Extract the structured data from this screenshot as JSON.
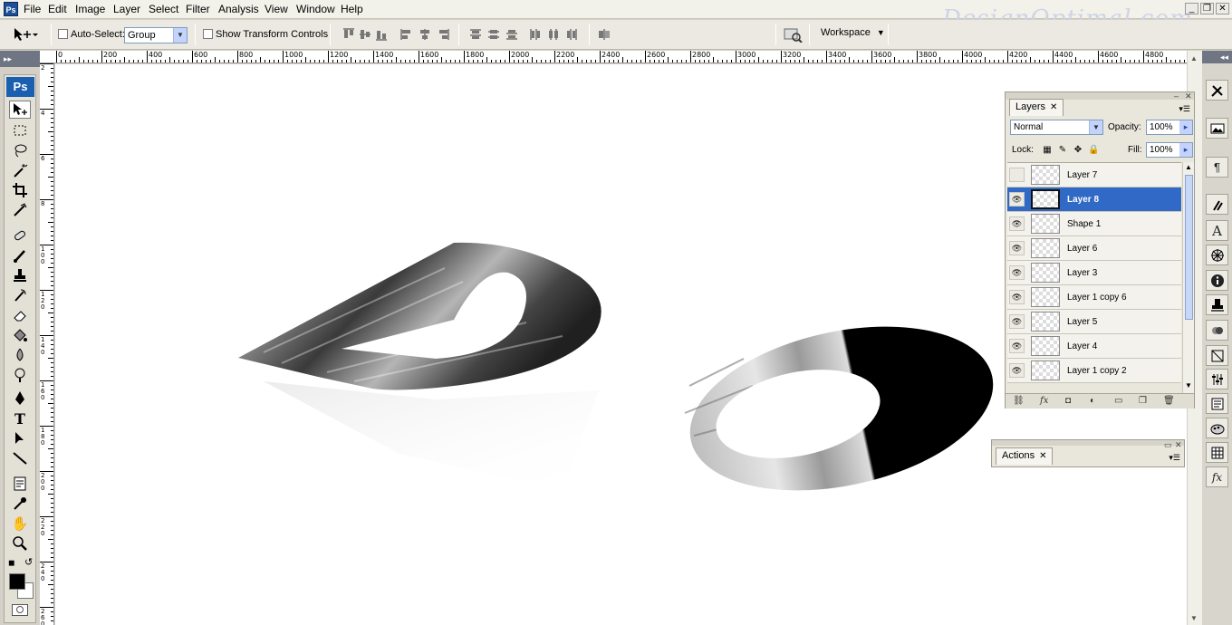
{
  "menubar": {
    "items": [
      "File",
      "Edit",
      "Image",
      "Layer",
      "Select",
      "Filter",
      "Analysis",
      "View",
      "Window",
      "Help"
    ],
    "watermark": "DesignOptimal.com"
  },
  "options": {
    "auto_select_label": "Auto-Select:",
    "auto_select_value": "Group",
    "show_transform_label": "Show Transform Controls",
    "workspace_label": "Workspace"
  },
  "ruler": {
    "top_labels": [
      "0",
      "200",
      "400",
      "600",
      "800",
      "1000",
      "1200",
      "1400",
      "1600",
      "1800",
      "2000",
      "2200",
      "2400",
      "2600",
      "2800",
      "3000",
      "3200",
      "3400",
      "3600",
      "3800",
      "4000",
      "4200",
      "4400",
      "4600",
      "4800"
    ],
    "left_labels": [
      "2",
      "4",
      "6",
      "8",
      "1\n0\n0",
      "1\n2\n0",
      "1\n4\n0",
      "1\n6\n0",
      "1\n8\n0",
      "2\n0\n0",
      "2\n2\n0",
      "2\n4\n0",
      "2\n6\n0"
    ]
  },
  "toolbox": {
    "logo": "Ps"
  },
  "layers_panel": {
    "tab_label": "Layers",
    "blend_mode": "Normal",
    "opacity_label": "Opacity:",
    "opacity_value": "100%",
    "lock_label": "Lock:",
    "fill_label": "Fill:",
    "fill_value": "100%",
    "layers": [
      {
        "name": "Layer 7",
        "visible": false,
        "selected": false
      },
      {
        "name": "Layer 8",
        "visible": true,
        "selected": true
      },
      {
        "name": "Shape 1",
        "visible": true,
        "selected": false
      },
      {
        "name": "Layer 6",
        "visible": true,
        "selected": false
      },
      {
        "name": "Layer 3",
        "visible": true,
        "selected": false
      },
      {
        "name": "Layer 1 copy 6",
        "visible": true,
        "selected": false
      },
      {
        "name": "Layer 5",
        "visible": true,
        "selected": false
      },
      {
        "name": "Layer 4",
        "visible": true,
        "selected": false
      },
      {
        "name": "Layer 1 copy 2",
        "visible": true,
        "selected": false
      }
    ]
  },
  "actions_panel": {
    "tab_label": "Actions"
  },
  "colors": {
    "selection": "#3169c6",
    "ps_blue": "#1b5fb0"
  }
}
